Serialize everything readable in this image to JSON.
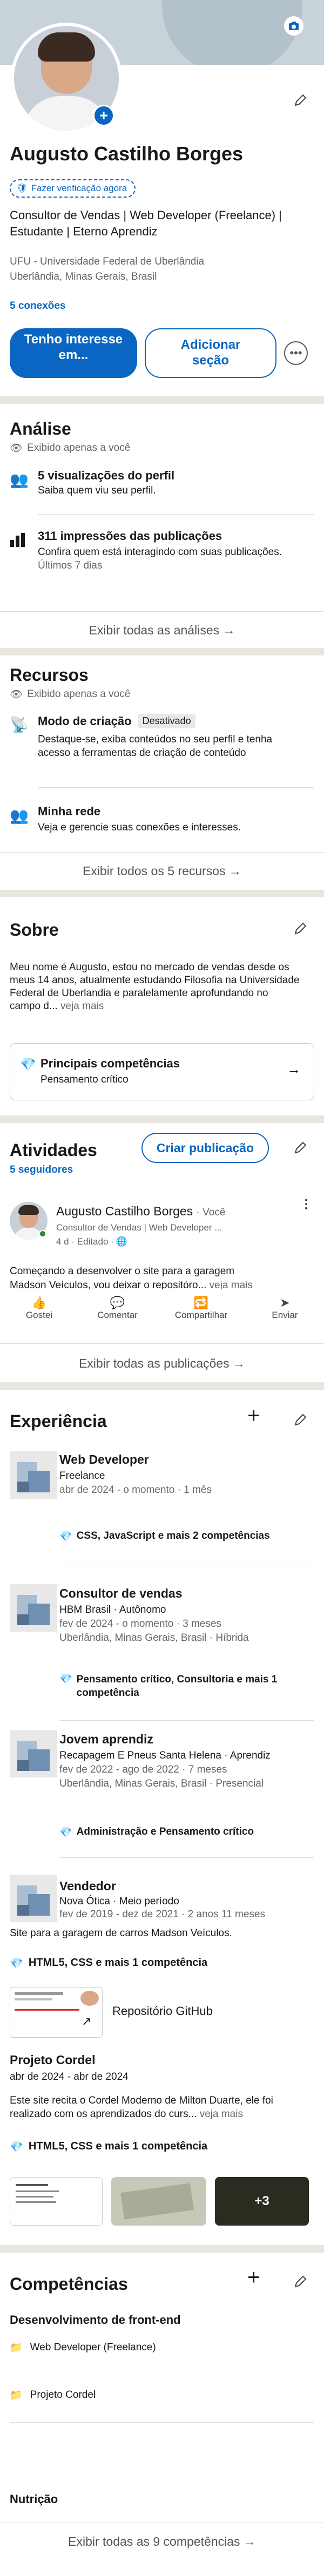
{
  "profile": {
    "name": "Augusto Castilho Borges",
    "verify": "Fazer verificação agora",
    "headline": "Consultor de Vendas | Web Developer (Freelance) | Estudante | Eterno Aprendiz",
    "education": "UFU - Universidade Federal de Uberlândia",
    "location": "Uberlândia, Minas Gerais, Brasil",
    "connections": "5 conexões",
    "btn_interest": "Tenho interesse em...",
    "btn_add": "Adicionar seção"
  },
  "analytics": {
    "title": "Análise",
    "private": "Exibido apenas a você",
    "views_title": "5 visualizações do perfil",
    "views_sub": "Saiba quem viu seu perfil.",
    "impr_title": "311 impressões das publicações",
    "impr_sub": "Confira quem está interagindo com suas publicações.",
    "impr_period": "Últimos 7 dias",
    "show_all": "Exibir todas as análises →"
  },
  "resources": {
    "title": "Recursos",
    "private": "Exibido apenas a você",
    "creator_title": "Modo de criação",
    "creator_badge": "Desativado",
    "creator_sub": "Destaque-se, exiba conteúdos no seu perfil e tenha acesso a ferramentas de criação de conteúdo",
    "network_title": "Minha rede",
    "network_sub": "Veja e gerencie suas conexões e interesses.",
    "show_all": "Exibir todos os 5 recursos →"
  },
  "about": {
    "title": "Sobre",
    "text": "Meu nome é Augusto, estou no mercado de vendas desde os meus 14 anos, atualmente estudando Filosofia na Universidade Federal de Uberlandia e paralelamente aprofundando no campo d...",
    "more": "veja mais",
    "skills_title": "Principais competências",
    "skills_sub": "Pensamento crítico"
  },
  "activity": {
    "title": "Atividades",
    "followers": "5 seguidores",
    "create_btn": "Criar publicação",
    "author": "Augusto Castilho Borges",
    "author_tag": "· Você",
    "author_sub": "Consultor de Vendas | Web Developer ...",
    "meta": "4 d · Editado · ",
    "post_l1": "Começando a desenvolver o site para a garagem",
    "post_l2": "Madson Veículos, vou deixar o repositóro...",
    "more": "veja mais",
    "actions": [
      "Gostei",
      "Comentar",
      "Compartilhar",
      "Enviar"
    ],
    "show_all": "Exibir todas as publicações →"
  },
  "experience": {
    "title": "Experiência",
    "items": [
      {
        "role": "Web Developer",
        "company": "Freelance",
        "dates": "abr de 2024 - o momento · 1 mês",
        "location": "",
        "skills": "CSS, JavaScript e mais 2 competências"
      },
      {
        "role": "Consultor de vendas",
        "company": "HBM Brasil · Autônomo",
        "dates": "fev de 2024 - o momento · 3 meses",
        "location": "Uberlândia, Minas Gerais, Brasil · Híbrida",
        "skills": "Pensamento crítico, Consultoria e mais 1 competência"
      },
      {
        "role": "Jovem aprendiz",
        "company": "Recapagem E Pneus Santa Helena · Aprendiz",
        "dates": "fev de 2022 - ago de 2022 · 7 meses",
        "location": "Uberlândia, Minas Gerais, Brasil · Presencial",
        "skills": "Administração e Pensamento crítico"
      },
      {
        "role": "Vendedor",
        "company": "Nova Ótica · Meio período",
        "dates": "fev de 2019 - dez de 2021 · 2 anos 11 meses",
        "location": "",
        "skills": ""
      }
    ]
  },
  "project": {
    "desc1": "Site para a garagem de carros Madson Veículos.",
    "skills1": "HTML5, CSS e mais 1 competência",
    "repo": "Repositório GitHub",
    "title": "Projeto Cordel",
    "dates": "abr de 2024 - abr de 2024",
    "desc": "Este site recita o Cordel Moderno de Milton Duarte, ele foi realizado com os aprendizados do curs...",
    "more": "veja mais",
    "skills2": "HTML5, CSS e mais 1 competência",
    "plus": "+3"
  },
  "competencies": {
    "title": "Competências",
    "group": "Desenvolvimento de front-end",
    "items": [
      "Web Developer (Freelance)",
      "Projeto Cordel"
    ],
    "next": "Nutrição",
    "show_all": "Exibir todas as 9 competências →"
  },
  "colors": {
    "brand": "#0a66c2",
    "separator": "#e9e5df"
  }
}
